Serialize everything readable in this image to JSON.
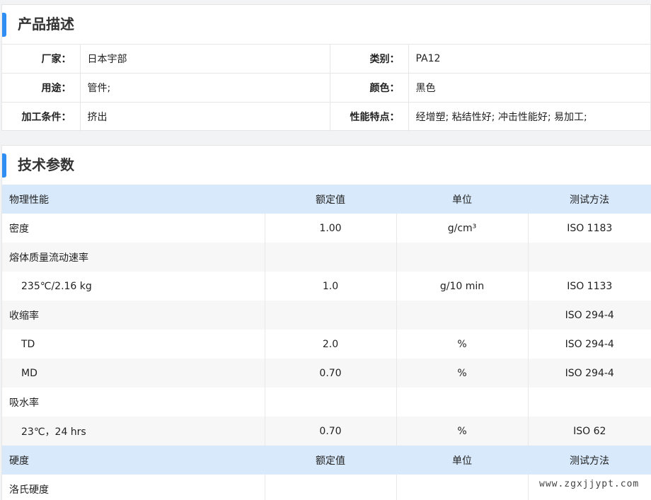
{
  "description": {
    "title": "产品描述",
    "rows": [
      [
        {
          "label": "厂家：",
          "value": "日本宇部"
        },
        {
          "label": "类别：",
          "value": "PA12"
        }
      ],
      [
        {
          "label": "用途：",
          "value": "管件;"
        },
        {
          "label": "颜色：",
          "value": "黑色"
        }
      ],
      [
        {
          "label": "加工条件：",
          "value": "挤出"
        },
        {
          "label": "性能特点：",
          "value": "经增塑; 粘结性好; 冲击性能好; 易加工;"
        }
      ]
    ]
  },
  "technical": {
    "title": "技术参数",
    "rows": [
      {
        "type": "header",
        "cells": [
          "物理性能",
          "额定值",
          "单位",
          "测试方法"
        ]
      },
      {
        "type": "row",
        "cells": [
          "密度",
          "1.00",
          "g/cm³",
          "ISO 1183"
        ]
      },
      {
        "type": "row",
        "cells": [
          "熔体质量流动速率",
          "",
          "",
          ""
        ]
      },
      {
        "type": "sub",
        "cells": [
          "235℃/2.16 kg",
          "1.0",
          "g/10 min",
          "ISO 1133"
        ],
        "link": true
      },
      {
        "type": "row",
        "cells": [
          "收缩率",
          "",
          "",
          "ISO 294-4"
        ]
      },
      {
        "type": "sub",
        "cells": [
          "TD",
          "2.0",
          "%",
          "ISO 294-4"
        ]
      },
      {
        "type": "sub",
        "cells": [
          "MD",
          "0.70",
          "%",
          "ISO 294-4"
        ]
      },
      {
        "type": "row",
        "cells": [
          "吸水率",
          "",
          "",
          ""
        ]
      },
      {
        "type": "sub",
        "cells": [
          "23℃，24 hrs",
          "0.70",
          "%",
          "ISO 62"
        ],
        "link": true
      },
      {
        "type": "header",
        "cells": [
          "硬度",
          "额定值",
          "单位",
          "测试方法"
        ]
      },
      {
        "type": "row",
        "cells": [
          "洛氏硬度",
          "",
          "",
          ""
        ]
      }
    ]
  },
  "watermark": "www.zgxjjypt.com"
}
